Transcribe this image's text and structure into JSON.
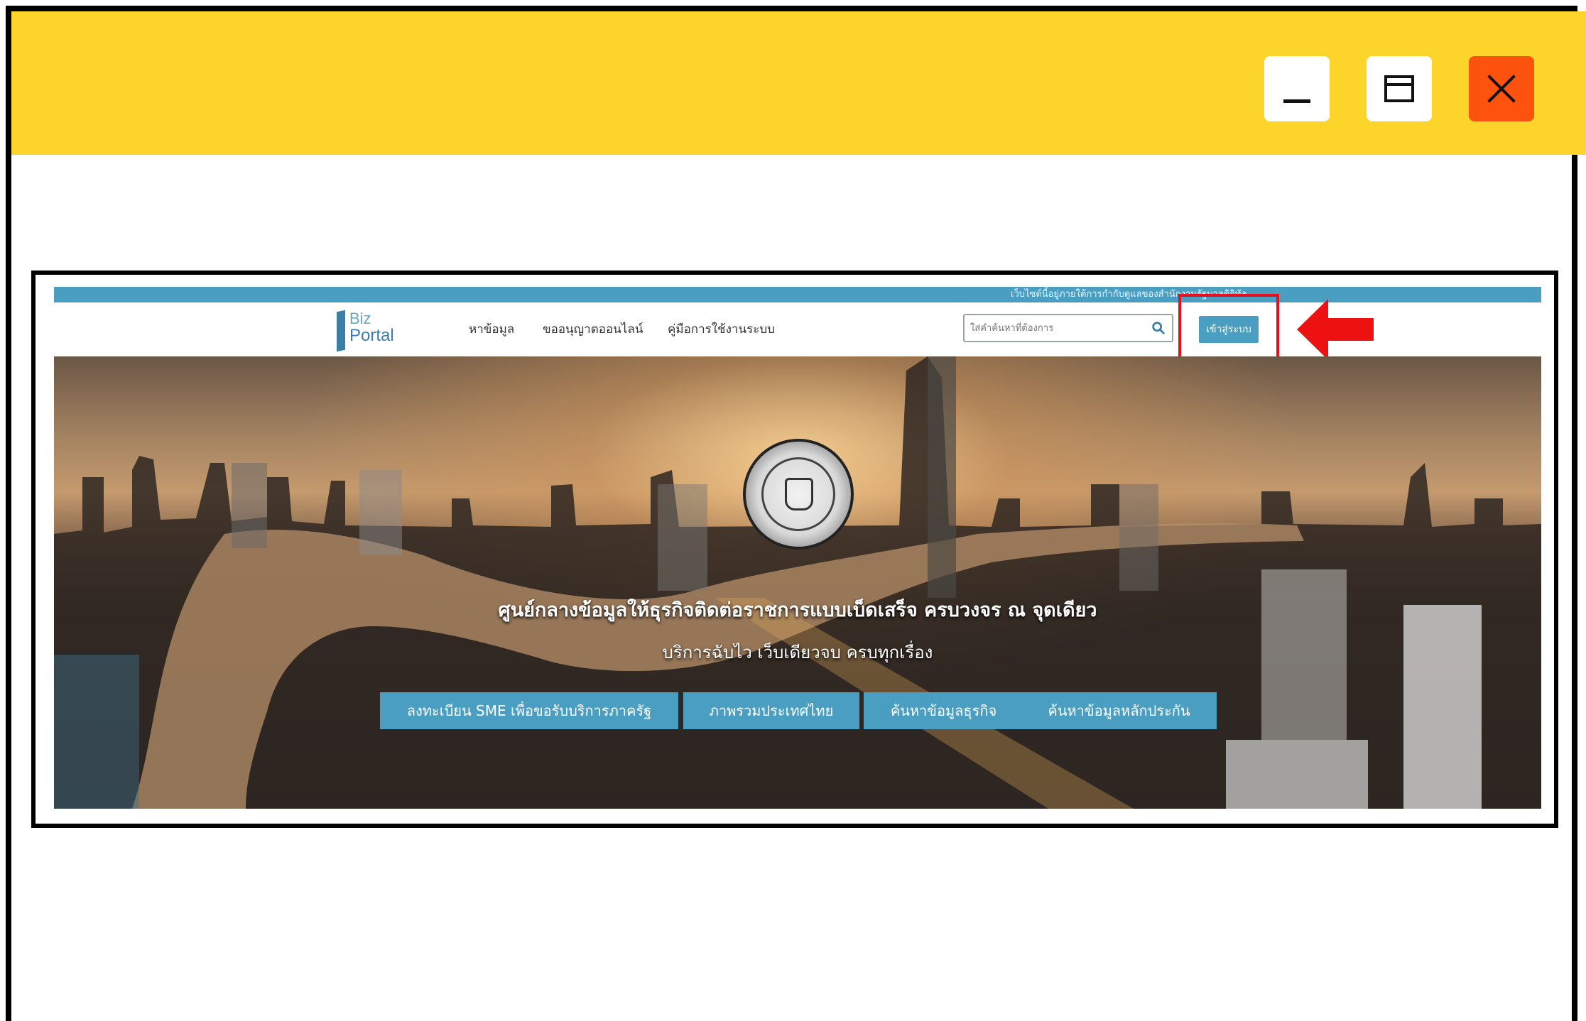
{
  "colors": {
    "title_bar": "#fdd42a",
    "close_button": "#fe520f",
    "site_accent": "#4a9ec2",
    "highlight": "#e8101c"
  },
  "window_controls": {
    "minimize_icon": "minimize-icon",
    "maximize_icon": "maximize-icon",
    "close_icon": "close-icon"
  },
  "site": {
    "notice": "เว็บไซต์นี้อยู่ภายใต้การกำกับดูแลของสำนักงานรัฐบาลดิจิทัล",
    "logo": {
      "line1": "Biz",
      "line2": "Portal"
    },
    "nav": [
      "หาข้อมูล",
      "ขออนุญาตออนไลน์",
      "คู่มือการใช้งานระบบ"
    ],
    "search": {
      "placeholder": "ใส่คำค้นหาที่ต้องการ",
      "value": ""
    },
    "login_label": "เข้าสู่ระบบ",
    "hero": {
      "title": "ศูนย์กลางข้อมูลให้ธุรกิจติดต่อราชการแบบเบ็ดเสร็จ ครบวงจร ณ จุดเดียว",
      "subtitle": "บริการฉับไว เว็บเดียวจบ ครบทุกเรื่อง",
      "buttons": [
        "ลงทะเบียน SME เพื่อขอรับบริการภาครัฐ",
        "ภาพรวมประเทศไทย",
        "ค้นหาข้อมูลธุรกิจ",
        "ค้นหาข้อมูลหลักประกัน"
      ]
    }
  }
}
